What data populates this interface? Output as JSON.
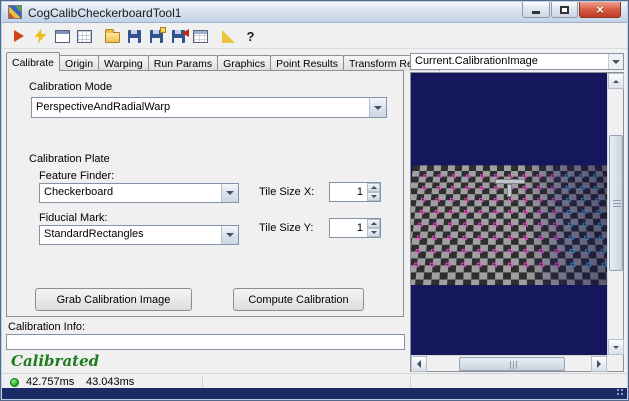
{
  "window": {
    "title": "CogCalibCheckerboardTool1",
    "controls": {
      "close": "×"
    }
  },
  "toolbar": {
    "icons": [
      {
        "name": "run",
        "glyph": ""
      },
      {
        "name": "electric-run",
        "glyph": ""
      },
      {
        "name": "image-window",
        "glyph": ""
      },
      {
        "name": "image-grid",
        "glyph": ""
      },
      {
        "name": "open",
        "glyph": ""
      },
      {
        "name": "save",
        "glyph": ""
      },
      {
        "name": "save-results",
        "glyph": ""
      },
      {
        "name": "import",
        "glyph": ""
      },
      {
        "name": "results-table",
        "glyph": ""
      },
      {
        "name": "graphics",
        "glyph": ""
      },
      {
        "name": "help",
        "glyph": "?"
      }
    ]
  },
  "tabs": [
    "Calibrate",
    "Origin",
    "Warping",
    "Run Params",
    "Graphics",
    "Point Results",
    "Transform Results"
  ],
  "calibrate_tab": {
    "calibration_mode": {
      "label": "Calibration Mode",
      "value": "PerspectiveAndRadialWarp"
    },
    "calibration_plate": {
      "label": "Calibration Plate",
      "feature_finder_label": "Feature Finder:",
      "feature_finder_value": "Checkerboard",
      "fiducial_mark_label": "Fiducial Mark:",
      "fiducial_mark_value": "StandardRectangles",
      "tile_size_x_label": "Tile Size X:",
      "tile_size_x_value": "1",
      "tile_size_y_label": "Tile Size Y:",
      "tile_size_y_value": "1"
    },
    "buttons": {
      "grab": "Grab Calibration Image",
      "compute": "Compute Calibration"
    }
  },
  "calibration_info": {
    "label": "Calibration Info:",
    "value": "",
    "status": "Calibrated",
    "status_color": "#1e7c1e"
  },
  "status_bar": {
    "time_a": "42.757ms",
    "time_b": "43.043ms"
  },
  "image_panel": {
    "selector": "Current.CalibrationImage",
    "overlay": {
      "rows": 8,
      "cols": 13,
      "marker_color": "#ff4fd8",
      "marker_color_alt": "#46c8ff",
      "background_color": "#14175c"
    }
  }
}
